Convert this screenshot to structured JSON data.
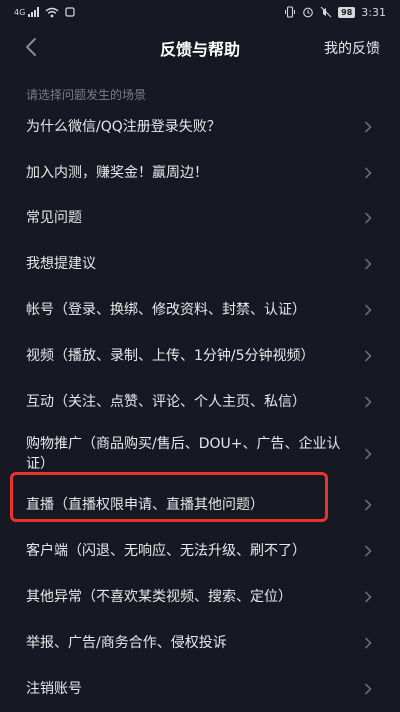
{
  "status_bar": {
    "network": "4G",
    "battery": "98",
    "time": "3:31"
  },
  "header": {
    "title": "反馈与帮助",
    "my_feedback": "我的反馈"
  },
  "section_label": "请选择问题发生的场景",
  "items": [
    {
      "label": "为什么微信/QQ注册登录失败？"
    },
    {
      "label": "加入内测，赚奖金！赢周边！"
    },
    {
      "label": "常见问题"
    },
    {
      "label": "我想提建议"
    },
    {
      "label": "帐号（登录、换绑、修改资料、封禁、认证）"
    },
    {
      "label": "视频（播放、录制、上传、1分钟/5分钟视频）"
    },
    {
      "label": "互动（关注、点赞、评论、个人主页、私信）"
    },
    {
      "label": "购物推广（商品购买/售后、DOU+、广告、企业认证）"
    },
    {
      "label": "直播（直播权限申请、直播其他问题）"
    },
    {
      "label": "客户端（闪退、无响应、无法升级、刷不了）"
    },
    {
      "label": "其他异常（不喜欢某类视频、搜索、定位）"
    },
    {
      "label": "举报、广告/商务合作、侵权投诉"
    },
    {
      "label": "注销账号"
    }
  ],
  "colors": {
    "background": "#161823",
    "highlight": "#e8342c"
  }
}
